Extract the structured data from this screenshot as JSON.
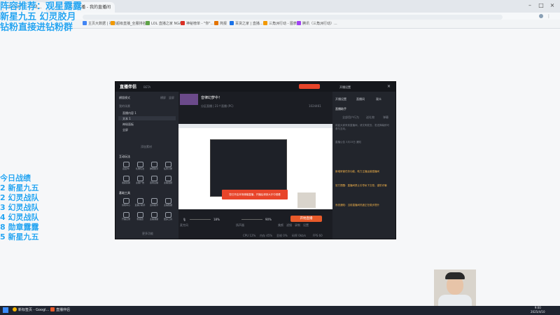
{
  "browser": {
    "tabs": [
      "数据概览 - 腾讯...",
      "虎牙直播 - 我的直播间"
    ],
    "bookmarks": [
      "应用",
      "主页大数据 | 神秘",
      "超级直播_全服排名...",
      "LOL 直播之家 NGA...",
      "神秘榜单 - \"你\"...",
      "简报",
      "百货之家 | 直播...",
      "三角洲行动 - 图表...",
      "腾讯（三角洲行动）..."
    ]
  },
  "overlay": {
    "lines": [
      "阵容推荐：观星露露",
      "新星九五 幻灵胶月",
      "钻粉直接进钻粉群"
    ],
    "record_title": "今日战绩",
    "records": [
      "2 新星九五",
      "2 幻灵战队",
      "3 幻灵战队",
      "4 幻灵战队",
      "8 勋章露露",
      "5 新星九五"
    ]
  },
  "app": {
    "logo": "直播伴侣",
    "version": "BETA",
    "title_buttons": [
      "开播设置",
      "设置"
    ],
    "left": {
      "mode": "横版模式",
      "mode_tabs": [
        "横屏",
        "竖屏"
      ],
      "scene_header": "我的场景",
      "scene_items": [
        "直播内容 1",
        "文本 1",
        "神秘面板",
        "全屏"
      ],
      "add_source": "添加素材",
      "interaction_title": "互动玩法",
      "interaction_items": [
        "连麦PK",
        "礼物玩法",
        "弹幕助手",
        "任务小屋",
        "发起投票",
        "主播广告",
        "连线主播",
        "主播话题"
      ],
      "tools_title": "基础工具",
      "tools_items": [
        "剪辑中心",
        "直播小助手",
        "道具助手",
        "主播数据",
        "开播记录",
        "粉丝团",
        "主播课堂",
        "更多工具"
      ],
      "more": "更多功能"
    },
    "center": {
      "stream_title": "音律幻梦中！",
      "stream_meta": "分区直播 | 21个直播 (PC)",
      "viewers": "1024461",
      "popup_text": "您已开启本场弹幕直播，开播后请到大厅中观看",
      "mic_label": "麦克风",
      "mic_level": "18%",
      "speaker_label": "扬声器",
      "speaker_level": "90%",
      "bottom_tools": [
        "美颜",
        "滤镜",
        "录制",
        "设置"
      ],
      "start_button": "开始直播",
      "status": [
        "CPU 12%",
        "内存 45%",
        "丢帧 0%",
        "码率 0kb/s",
        "FPS 60"
      ]
    },
    "right": {
      "tabs": [
        "开播设置",
        "直播间",
        "观众"
      ],
      "assistant_title": "直播助手",
      "sub_tabs": [
        "全部用户行为",
        "送礼物",
        "弹幕"
      ],
      "hint": "欢迎大家来到直播间，请文明发言，发送弹幕即可参与互动。",
      "notice": "直播公告 3月15日 通知",
      "messages": [
        "新增房管任务功能，助力主播运营直播间",
        "官方提醒：直播间禁止引导私下交易，谨防诈骗",
        "系统通知：当前直播间热度正在稳步提升"
      ]
    }
  },
  "taskbar": {
    "items": [
      "新标签页 - Googl...",
      "直播伴侣"
    ],
    "time": "9:00",
    "date": "2025/4/10"
  }
}
